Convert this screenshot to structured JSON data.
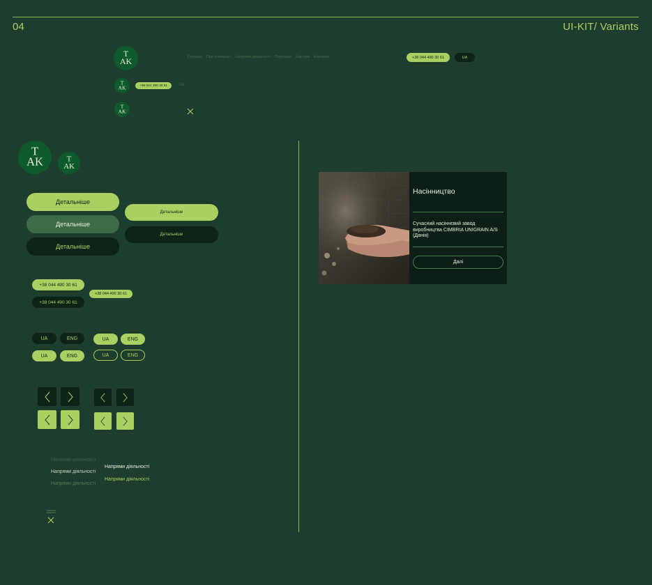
{
  "header": {
    "number": "04",
    "title": "UI-KIT/ Variants"
  },
  "logo_text": {
    "top": "T",
    "bottom": "AK"
  },
  "nav": {
    "links": [
      "Головна",
      "Про компанію",
      "Напрями діяльності",
      "Партнери",
      "Кар'єра",
      "Контакти"
    ],
    "phone": "+38 044 490 30 61",
    "lang": "UA"
  },
  "nav_small": {
    "phone": "+38 044 490 30 61",
    "menu_label": "UA"
  },
  "buttons": {
    "more": "Детальніше"
  },
  "phones": {
    "value": "+38 044 490 30 61"
  },
  "langs": {
    "ua": "UA",
    "eng": "ENG"
  },
  "menu_items": {
    "label": "Напрями діяльності"
  },
  "card": {
    "title": "Насінництво",
    "description": "Сучасний насіннєвий завод виробництва CIMBRIA UNIGRAIN A/S (Данія)",
    "button": "Далі"
  },
  "colors": {
    "background": "#1d3d2f",
    "accent": "#a9d162",
    "dark": "#0d2418",
    "logo": "#0e5a2c"
  }
}
